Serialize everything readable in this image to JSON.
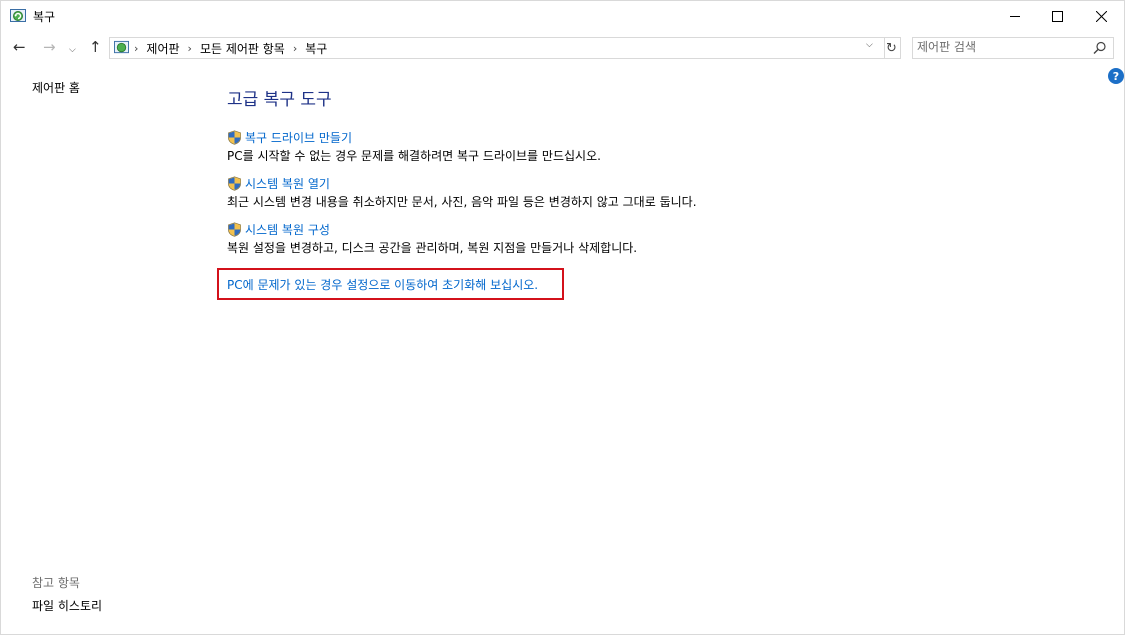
{
  "window": {
    "title": "복구"
  },
  "nav": {
    "back_icon": "back-arrow-icon",
    "forward_icon": "forward-arrow-icon",
    "up_icon": "up-arrow-icon",
    "breadcrumbs": [
      "제어판",
      "모든 제어판 항목",
      "복구"
    ],
    "search_placeholder": "제어판 검색"
  },
  "left_pane": {
    "home_link": "제어판 홈",
    "see_also_heading": "참고 항목",
    "see_also_items": [
      "파일 히스토리"
    ]
  },
  "main": {
    "title": "고급 복구 도구",
    "tasks": [
      {
        "link": "복구 드라이브 만들기",
        "desc": "PC를 시작할 수 없는 경우 문제를 해결하려면 복구 드라이브를 만드십시오.",
        "icon": "uac-shield-icon"
      },
      {
        "link": "시스템 복원 열기",
        "desc": "최근 시스템 변경 내용을 취소하지만 문서, 사진, 음악 파일 등은 변경하지 않고 그대로 둡니다.",
        "icon": "uac-shield-icon"
      },
      {
        "link": "시스템 복원 구성",
        "desc": "복원 설정을 변경하고, 디스크 공간을 관리하며, 복원 지점을 만들거나 삭제합니다.",
        "icon": "uac-shield-icon"
      }
    ],
    "reset_link": "PC에 문제가 있는 경우 설정으로 이동하여 초기화해 보십시오."
  },
  "colors": {
    "link": "#0066cc",
    "heading": "#1e3287",
    "highlight_border": "#d3111b"
  }
}
